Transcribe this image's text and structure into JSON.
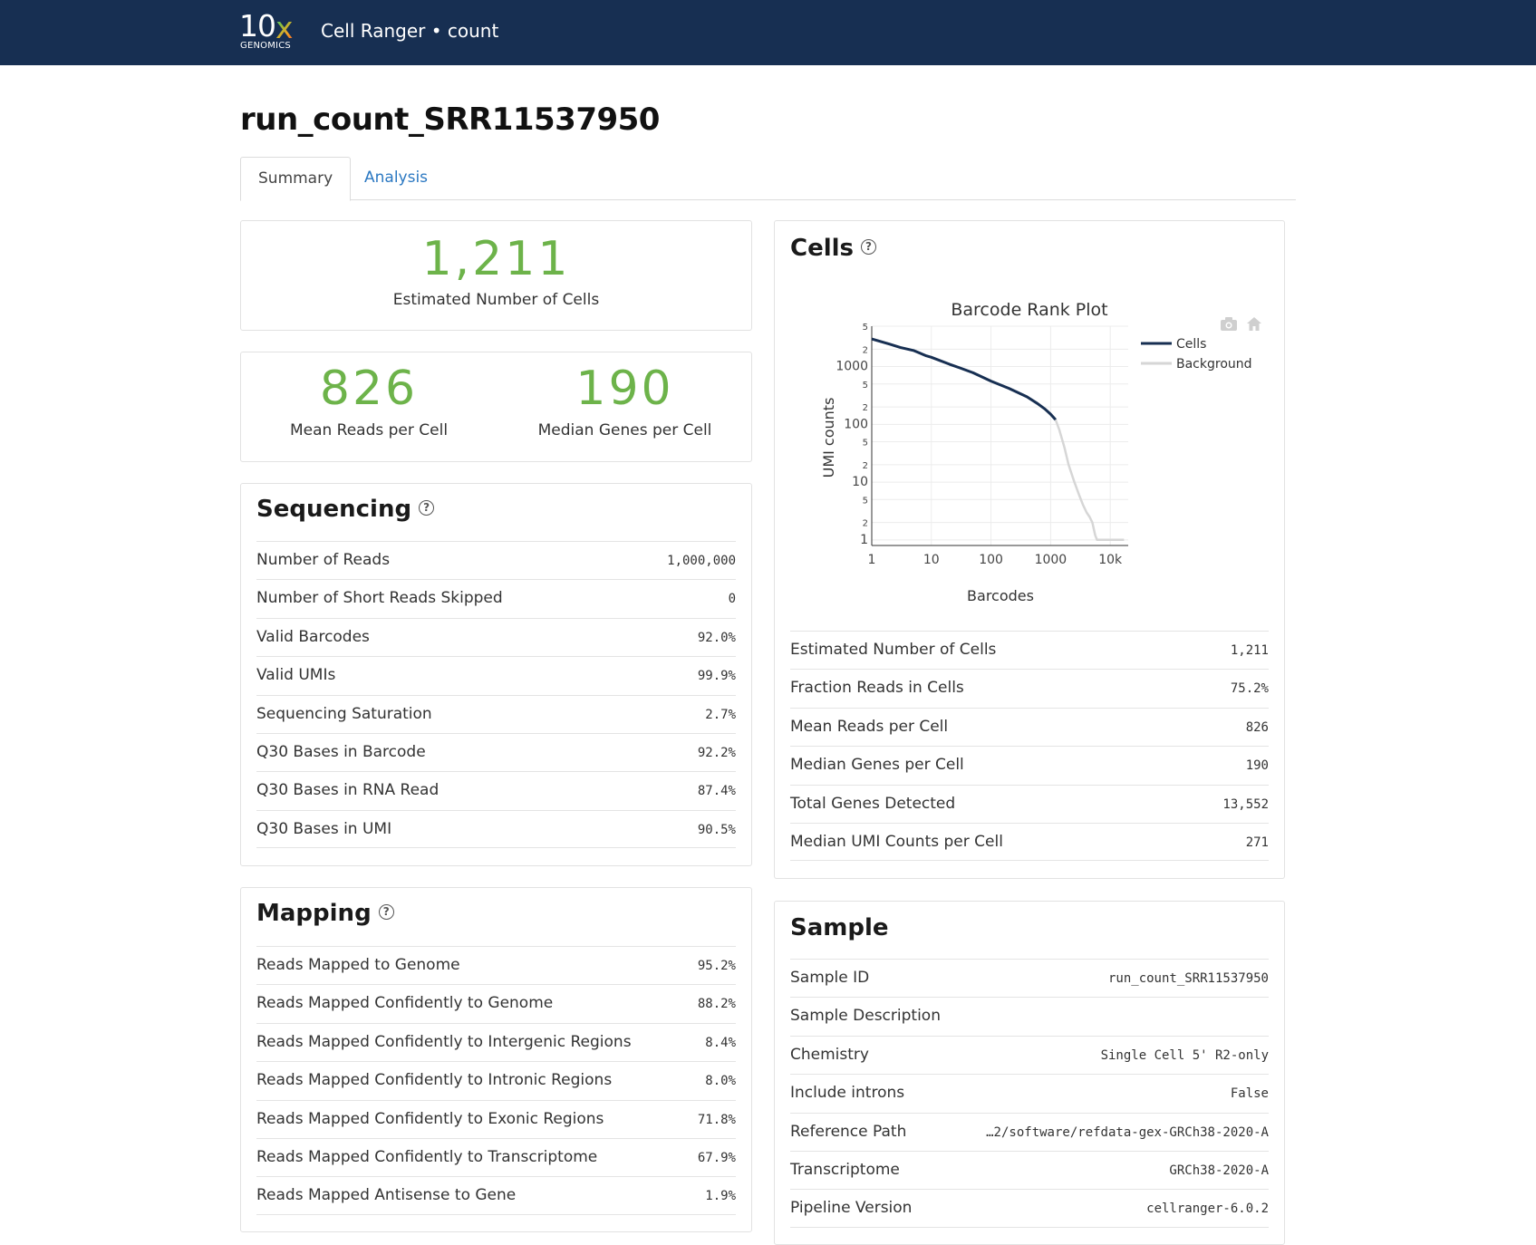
{
  "header": {
    "logo_main": "10",
    "logo_x": "x",
    "logo_sub": "GENOMICS",
    "app_title": "Cell Ranger • count"
  },
  "page": {
    "run_title": "run_count_SRR11537950",
    "tabs": [
      {
        "label": "Summary",
        "active": true
      },
      {
        "label": "Analysis",
        "active": false
      }
    ]
  },
  "hero": {
    "cells_value": "1,211",
    "cells_label": "Estimated Number of Cells",
    "mean_reads_value": "826",
    "mean_reads_label": "Mean Reads per Cell",
    "median_genes_value": "190",
    "median_genes_label": "Median Genes per Cell",
    "accent_color": "#6db34a"
  },
  "sequencing": {
    "title": "Sequencing",
    "help_icon": "question-circle-icon",
    "rows": [
      {
        "label": "Number of Reads",
        "value": "1,000,000"
      },
      {
        "label": "Number of Short Reads Skipped",
        "value": "0"
      },
      {
        "label": "Valid Barcodes",
        "value": "92.0%"
      },
      {
        "label": "Valid UMIs",
        "value": "99.9%"
      },
      {
        "label": "Sequencing Saturation",
        "value": "2.7%"
      },
      {
        "label": "Q30 Bases in Barcode",
        "value": "92.2%"
      },
      {
        "label": "Q30 Bases in RNA Read",
        "value": "87.4%"
      },
      {
        "label": "Q30 Bases in UMI",
        "value": "90.5%"
      }
    ]
  },
  "mapping": {
    "title": "Mapping",
    "help_icon": "question-circle-icon",
    "rows": [
      {
        "label": "Reads Mapped to Genome",
        "value": "95.2%"
      },
      {
        "label": "Reads Mapped Confidently to Genome",
        "value": "88.2%"
      },
      {
        "label": "Reads Mapped Confidently to Intergenic Regions",
        "value": "8.4%"
      },
      {
        "label": "Reads Mapped Confidently to Intronic Regions",
        "value": "8.0%"
      },
      {
        "label": "Reads Mapped Confidently to Exonic Regions",
        "value": "71.8%"
      },
      {
        "label": "Reads Mapped Confidently to Transcriptome",
        "value": "67.9%"
      },
      {
        "label": "Reads Mapped Antisense to Gene",
        "value": "1.9%"
      }
    ]
  },
  "cells": {
    "title": "Cells",
    "help_icon": "question-circle-icon",
    "toolbar_icons": [
      "camera-icon",
      "home-icon"
    ],
    "rows": [
      {
        "label": "Estimated Number of Cells",
        "value": "1,211"
      },
      {
        "label": "Fraction Reads in Cells",
        "value": "75.2%"
      },
      {
        "label": "Mean Reads per Cell",
        "value": "826"
      },
      {
        "label": "Median Genes per Cell",
        "value": "190"
      },
      {
        "label": "Total Genes Detected",
        "value": "13,552"
      },
      {
        "label": "Median UMI Counts per Cell",
        "value": "271"
      }
    ]
  },
  "sample": {
    "title": "Sample",
    "rows": [
      {
        "label": "Sample ID",
        "value": "run_count_SRR11537950"
      },
      {
        "label": "Sample Description",
        "value": ""
      },
      {
        "label": "Chemistry",
        "value": "Single Cell 5' R2-only"
      },
      {
        "label": "Include introns",
        "value": "False"
      },
      {
        "label": "Reference Path",
        "value": "…2/software/refdata-gex-GRCh38-2020-A"
      },
      {
        "label": "Transcriptome",
        "value": "GRCh38-2020-A"
      },
      {
        "label": "Pipeline Version",
        "value": "cellranger-6.0.2"
      }
    ]
  },
  "chart_data": {
    "type": "line",
    "title": "Barcode Rank Plot",
    "xlabel": "Barcodes",
    "ylabel": "UMI counts",
    "xscale": "log",
    "yscale": "log",
    "xlim": [
      1,
      20000
    ],
    "ylim": [
      0.8,
      5000
    ],
    "x_ticks": [
      "1",
      "10",
      "100",
      "1000",
      "10k"
    ],
    "y_ticks": [
      "1",
      "2",
      "5",
      "10",
      "2",
      "5",
      "100",
      "2",
      "5",
      "1000",
      "2",
      "5"
    ],
    "legend_position": "top-right",
    "grid": true,
    "series": [
      {
        "name": "Cells",
        "color": "#172f52",
        "points": [
          [
            1,
            3000
          ],
          [
            2,
            2450
          ],
          [
            3,
            2150
          ],
          [
            5,
            1900
          ],
          [
            8,
            1550
          ],
          [
            10,
            1450
          ],
          [
            20,
            1100
          ],
          [
            30,
            950
          ],
          [
            50,
            780
          ],
          [
            100,
            560
          ],
          [
            200,
            420
          ],
          [
            400,
            300
          ],
          [
            600,
            230
          ],
          [
            800,
            185
          ],
          [
            1000,
            150
          ],
          [
            1211,
            120
          ]
        ]
      },
      {
        "name": "Background",
        "color": "#d6d6d6",
        "points": [
          [
            1211,
            120
          ],
          [
            1400,
            80
          ],
          [
            1700,
            40
          ],
          [
            2000,
            20
          ],
          [
            2500,
            10
          ],
          [
            3000,
            6
          ],
          [
            3500,
            4
          ],
          [
            4000,
            3
          ],
          [
            4500,
            2.5
          ],
          [
            5000,
            2
          ],
          [
            5600,
            1.2
          ],
          [
            6000,
            1
          ],
          [
            10000,
            1
          ],
          [
            17000,
            1
          ]
        ]
      }
    ]
  }
}
